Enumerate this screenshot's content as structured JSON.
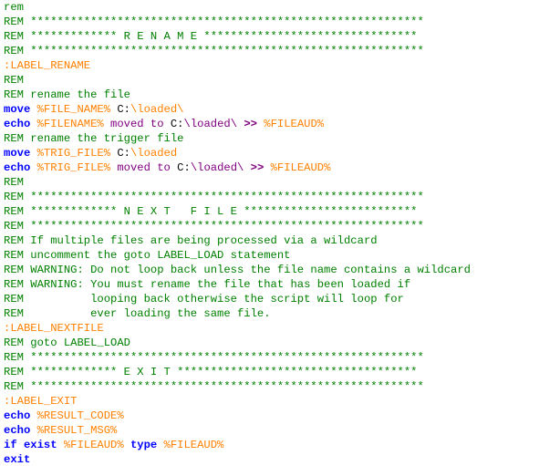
{
  "colors": {
    "comment": "#008000",
    "label": "#FF8000",
    "keyword": "#0000FF",
    "variable": "#FF8000",
    "text": "#000000",
    "operator": "#800080",
    "background": "#FFFFFF"
  },
  "lines": [
    [
      {
        "c": "rem",
        "t": "rem"
      }
    ],
    [
      {
        "c": "rem",
        "t": "REM ***********************************************************"
      }
    ],
    [
      {
        "c": "rem",
        "t": "REM ************* R E N A M E ********************************"
      }
    ],
    [
      {
        "c": "rem",
        "t": "REM ***********************************************************"
      }
    ],
    [
      {
        "c": "label",
        "t": ":LABEL_RENAME"
      }
    ],
    [
      {
        "c": "rem",
        "t": "REM"
      }
    ],
    [
      {
        "c": "rem",
        "t": "REM rename the file"
      }
    ],
    [
      {
        "c": "kw",
        "t": "move "
      },
      {
        "c": "var",
        "t": "%FILE_NAME%"
      },
      {
        "c": "txt",
        "t": " C:"
      },
      {
        "c": "var",
        "t": "\\loaded\\"
      }
    ],
    [
      {
        "c": "kw",
        "t": "echo "
      },
      {
        "c": "var",
        "t": "%FILENAME%"
      },
      {
        "c": "purple",
        "t": " moved to "
      },
      {
        "c": "txt",
        "t": "C:"
      },
      {
        "c": "purple",
        "t": "\\loaded\\ "
      },
      {
        "c": "op",
        "t": ">>"
      },
      {
        "c": "txt",
        "t": " "
      },
      {
        "c": "var",
        "t": "%FILEAUD%"
      }
    ],
    [
      {
        "c": "rem",
        "t": "REM rename the trigger file"
      }
    ],
    [
      {
        "c": "kw",
        "t": "move "
      },
      {
        "c": "var",
        "t": "%TRIG_FILE%"
      },
      {
        "c": "txt",
        "t": " C:"
      },
      {
        "c": "var",
        "t": "\\loaded"
      }
    ],
    [
      {
        "c": "kw",
        "t": "echo "
      },
      {
        "c": "var",
        "t": "%TRIG_FILE%"
      },
      {
        "c": "purple",
        "t": " moved to "
      },
      {
        "c": "txt",
        "t": "C:"
      },
      {
        "c": "purple",
        "t": "\\loaded\\ "
      },
      {
        "c": "op",
        "t": ">>"
      },
      {
        "c": "txt",
        "t": " "
      },
      {
        "c": "var",
        "t": "%FILEAUD%"
      }
    ],
    [
      {
        "c": "rem",
        "t": "REM"
      }
    ],
    [
      {
        "c": "rem",
        "t": "REM ***********************************************************"
      }
    ],
    [
      {
        "c": "rem",
        "t": "REM ************* N E X T   F I L E **************************"
      }
    ],
    [
      {
        "c": "rem",
        "t": "REM ***********************************************************"
      }
    ],
    [
      {
        "c": "rem",
        "t": "REM If multiple files are being processed via a wildcard"
      }
    ],
    [
      {
        "c": "rem",
        "t": "REM uncomment the goto LABEL_LOAD statement"
      }
    ],
    [
      {
        "c": "rem",
        "t": "REM WARNING: Do not loop back unless the file name contains a wildcard"
      }
    ],
    [
      {
        "c": "rem",
        "t": "REM WARNING: You must rename the file that has been loaded if"
      }
    ],
    [
      {
        "c": "rem",
        "t": "REM          looping back otherwise the script will loop for"
      }
    ],
    [
      {
        "c": "rem",
        "t": "REM          ever loading the same file."
      }
    ],
    [
      {
        "c": "label",
        "t": ":LABEL_NEXTFILE"
      }
    ],
    [
      {
        "c": "rem",
        "t": "REM goto LABEL_LOAD"
      }
    ],
    [
      {
        "c": "rem",
        "t": "REM ***********************************************************"
      }
    ],
    [
      {
        "c": "rem",
        "t": "REM ************* E X I T ************************************"
      }
    ],
    [
      {
        "c": "rem",
        "t": "REM ***********************************************************"
      }
    ],
    [
      {
        "c": "label",
        "t": ":LABEL_EXIT"
      }
    ],
    [
      {
        "c": "kw",
        "t": "echo "
      },
      {
        "c": "var",
        "t": "%RESULT_CODE%"
      }
    ],
    [
      {
        "c": "kw",
        "t": "echo "
      },
      {
        "c": "var",
        "t": "%RESULT_MSG%"
      }
    ],
    [
      {
        "c": "kw",
        "t": "if exist "
      },
      {
        "c": "var",
        "t": "%FILEAUD%"
      },
      {
        "c": "kw",
        "t": " type "
      },
      {
        "c": "var",
        "t": "%FILEAUD%"
      }
    ],
    [
      {
        "c": "kw",
        "t": "exit"
      }
    ]
  ]
}
